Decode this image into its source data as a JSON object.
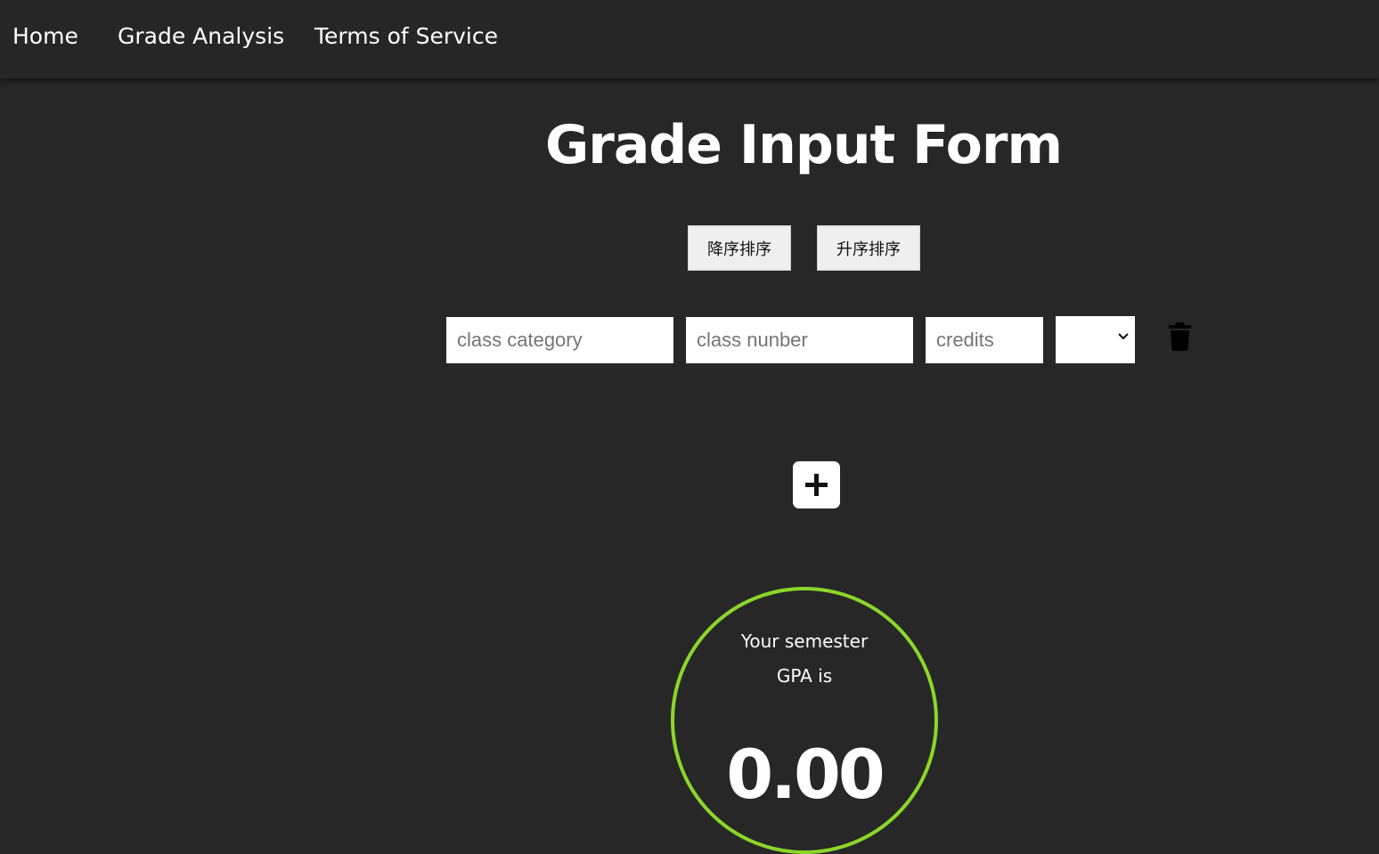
{
  "nav": {
    "home": "Home",
    "grade_analysis": "Grade Analysis",
    "terms": "Terms of Service"
  },
  "page_title": "Grade Input Form",
  "sort": {
    "descending": "降序排序",
    "ascending": "升序排序"
  },
  "course_row": {
    "category_placeholder": "class category",
    "number_placeholder": "class nunber",
    "credits_placeholder": "credits",
    "grade_selected": "",
    "delete_icon": "trash-icon"
  },
  "add_icon": "plus-icon",
  "gpa": {
    "label_line1": "Your semester",
    "label_line2": "GPA is",
    "value": "0.00",
    "ring_color": "#8bd62a"
  },
  "colors": {
    "background": "#272727",
    "navbar": "#262626"
  }
}
